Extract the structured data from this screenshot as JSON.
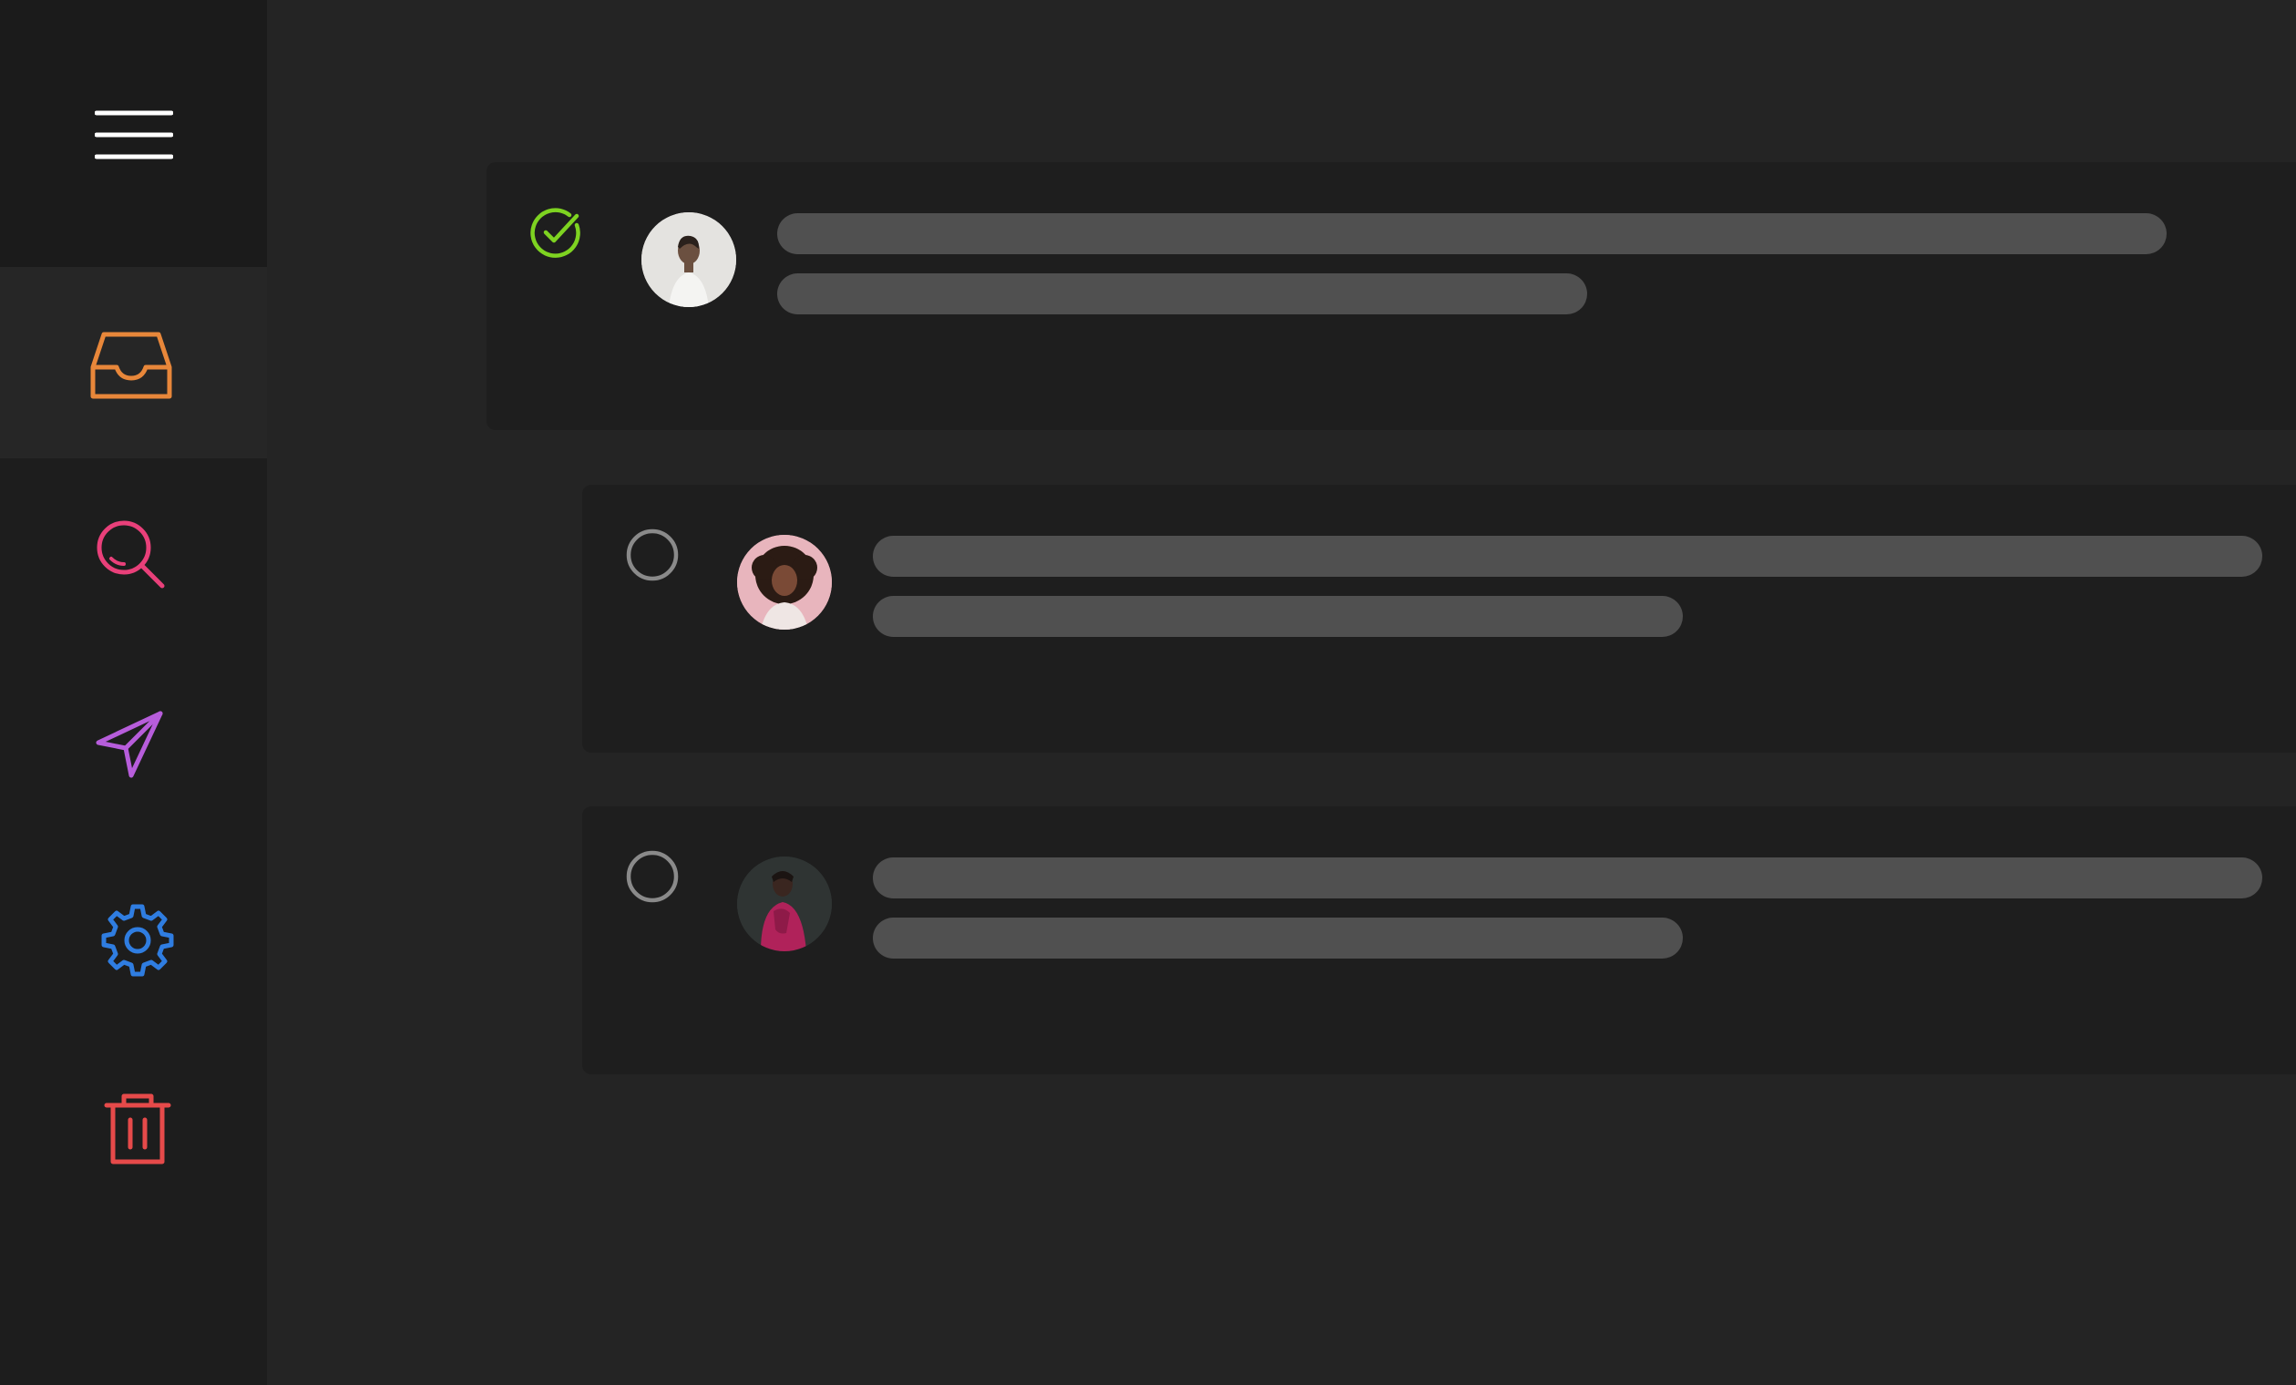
{
  "sidebar": {
    "menu_icon": "hamburger-menu-icon",
    "items": [
      {
        "id": "inbox",
        "icon": "inbox-icon",
        "color": "#e8873a",
        "active": true
      },
      {
        "id": "search",
        "icon": "search-icon",
        "color": "#e9407a",
        "active": false
      },
      {
        "id": "sent",
        "icon": "send-icon",
        "color": "#b75ddb",
        "active": false
      },
      {
        "id": "settings",
        "icon": "gear-icon",
        "color": "#2f7de1",
        "active": false
      },
      {
        "id": "trash",
        "icon": "trash-icon",
        "color": "#e64a4a",
        "active": false
      }
    ]
  },
  "messages": [
    {
      "selected": true,
      "check_color": "#7ed321",
      "avatar": "avatar-man-white-shirt"
    },
    {
      "selected": false,
      "avatar": "avatar-woman-curly-hair"
    },
    {
      "selected": false,
      "avatar": "avatar-woman-pink-jacket"
    }
  ],
  "colors": {
    "background": "#242424",
    "sidebar": "#1d1d1d",
    "card": "#1e1e1e",
    "skeleton": "#505050"
  }
}
